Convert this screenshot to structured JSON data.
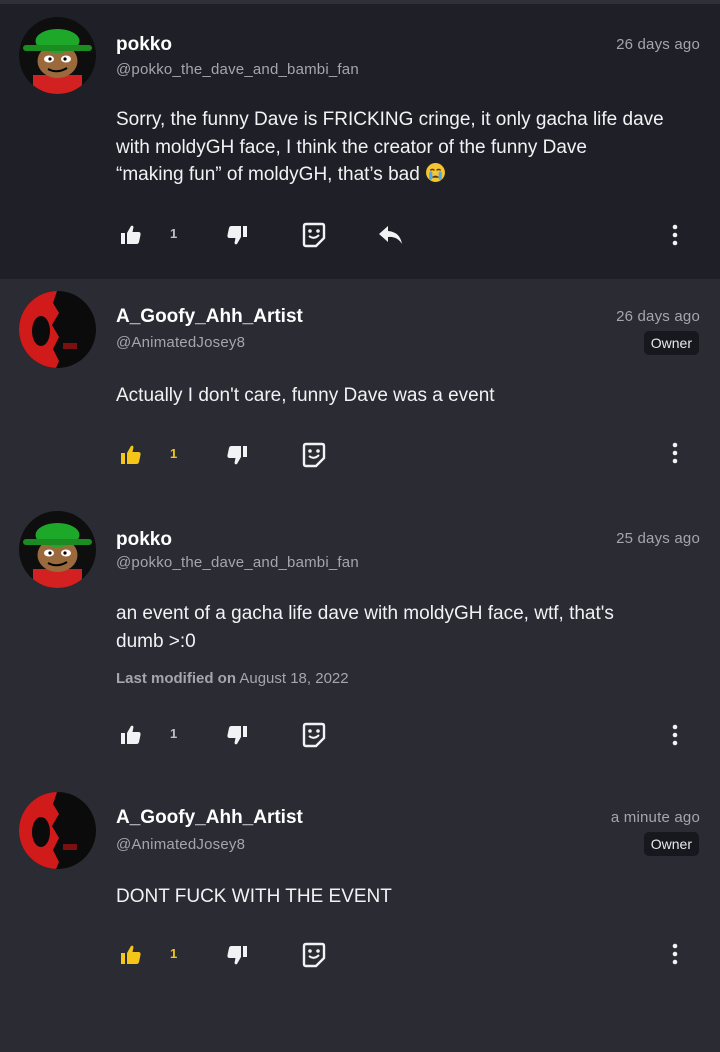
{
  "comments": [
    {
      "username": "pokko",
      "handle": "@pokko_the_dave_and_bambi_fan",
      "time": "26 days ago",
      "badge": "",
      "text": "Sorry, the funny Dave is FRICKING cringe, it only gacha life dave\nwith moldyGH face, I think the creator of the funny Dave\n“making fun” of moldyGH, that’s bad",
      "emoji": "crying-face",
      "modified_label": "",
      "modified_date": "",
      "likes": "1",
      "liked": false,
      "avatar": "green-hat-avatar"
    },
    {
      "username": "A_Goofy_Ahh_Artist",
      "handle": "@AnimatedJosey8",
      "time": "26 days ago",
      "badge": "Owner",
      "text": "Actually I don't care, funny Dave was a event",
      "modified_label": "",
      "modified_date": "",
      "likes": "1",
      "liked": true,
      "avatar": "red-black-avatar"
    },
    {
      "username": "pokko",
      "handle": "@pokko_the_dave_and_bambi_fan",
      "time": "25 days ago",
      "badge": "",
      "text": "an event of a gacha life dave with moldyGH face, wtf, that's\ndumb >:0",
      "modified_label": "Last modified on",
      "modified_date": "August 18, 2022",
      "likes": "1",
      "liked": false,
      "avatar": "green-hat-avatar"
    },
    {
      "username": "A_Goofy_Ahh_Artist",
      "handle": "@AnimatedJosey8",
      "time": "a minute ago",
      "badge": "Owner",
      "text": "DONT FUCK WITH THE EVENT",
      "modified_label": "",
      "modified_date": "",
      "likes": "1",
      "liked": true,
      "avatar": "red-black-avatar"
    }
  ],
  "colors": {
    "background": "#2a2b33",
    "highlight_background": "#1f2027",
    "like_active": "#f5c518",
    "muted_text": "#a4a6ae"
  },
  "icons": [
    "thumbs-up-icon",
    "thumbs-down-icon",
    "emoji-react-icon",
    "reply-icon",
    "more-vertical-icon"
  ]
}
